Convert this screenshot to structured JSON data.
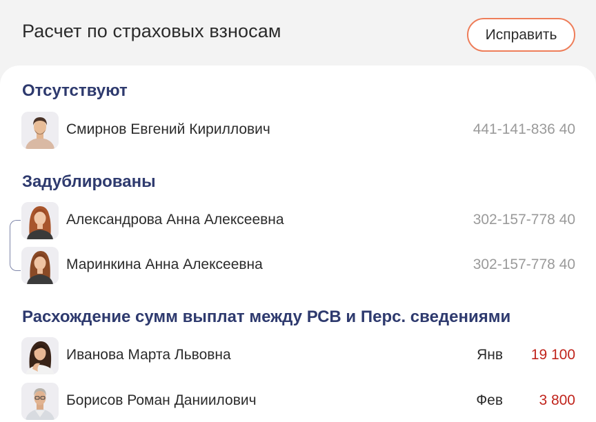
{
  "header": {
    "title": "Расчет по страховых взносам",
    "fix_button_label": "Исправить"
  },
  "sections": {
    "missing": {
      "title": "Отсутствуют",
      "rows": [
        {
          "name": "Смирнов Евгений Кириллович",
          "snils": "441-141-836 40"
        }
      ]
    },
    "duplicated": {
      "title": "Задублированы",
      "rows": [
        {
          "name": "Александрова Анна Алексеевна",
          "snils": "302-157-778 40"
        },
        {
          "name": "Маринкина Анна Алексеевна",
          "snils": "302-157-778 40"
        }
      ]
    },
    "mismatch": {
      "title": "Расхождение сумм выплат между РСВ и Перс. сведениями",
      "rows": [
        {
          "name": "Иванова Марта Львовна",
          "month": "Янв",
          "amount": "19 100"
        },
        {
          "name": "Борисов Роман Даниилович",
          "month": "Фев",
          "amount": "3 800"
        }
      ]
    }
  },
  "colors": {
    "accent_border": "#ee7d59",
    "section_title": "#2e3a6e",
    "amount": "#c0241c",
    "muted": "#9a9a9a"
  }
}
